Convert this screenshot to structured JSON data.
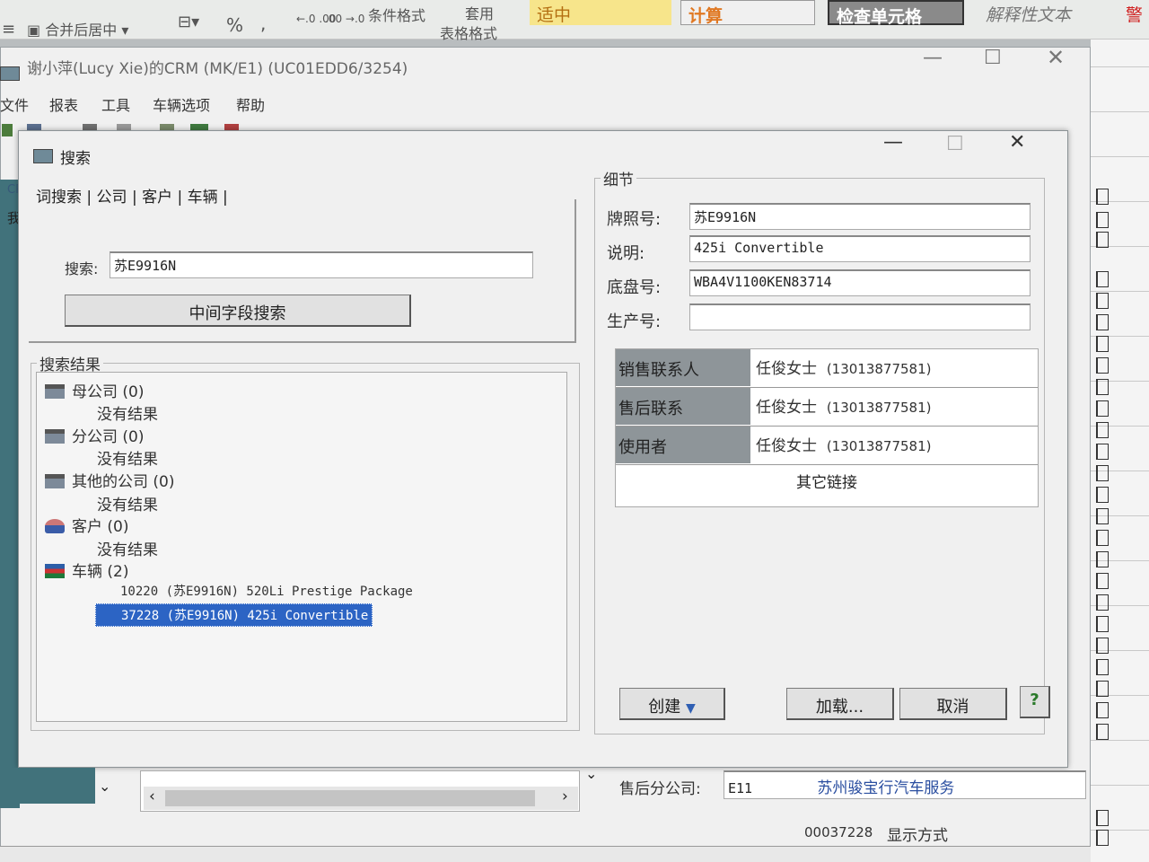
{
  "excel_ribbon": {
    "merge_center": "合并后居中",
    "percent": "%",
    "comma": ",",
    "decimal_increase": "←.0 .00",
    "decimal_decrease": ".00 →.0",
    "conditional_format": "条件格式",
    "apply_table_format_1": "套用",
    "apply_table_format_2": "表格格式",
    "style_neutral": "适中",
    "style_calc": "计算",
    "style_check_cell": "检查单元格",
    "style_explanatory": "解释性文本",
    "style_warning": "警"
  },
  "crm_window": {
    "title": "谢小萍(Lucy Xie)的CRM (MK/E1) (UC01EDD6/3254)",
    "menu": [
      "文件",
      "报表",
      "工具",
      "车辆选项",
      "帮助"
    ]
  },
  "dialog": {
    "title": "搜索",
    "search_tabs": "词搜索 | 公司 | 客户 | 车辆 |",
    "search_label": "搜索:",
    "search_value": "苏E9916N",
    "mid_field_search_button": "中间字段搜索",
    "results_legend": "搜索结果",
    "results": [
      {
        "label": "母公司",
        "count": "(0)",
        "icon": "factory-icon",
        "child": "没有结果"
      },
      {
        "label": "分公司",
        "count": "(0)",
        "icon": "factory-icon",
        "child": "没有结果"
      },
      {
        "label": "其他的公司",
        "count": "(0)",
        "icon": "factory-icon",
        "child": "没有结果"
      },
      {
        "label": "客户",
        "count": "(0)",
        "icon": "customer-icon",
        "child": "没有结果"
      },
      {
        "label": "车辆",
        "count": "(2)",
        "icon": "vehicle-icon"
      }
    ],
    "vehicle_results": [
      "10220 (苏E9916N) 520Li Prestige Package",
      "37228 (苏E9916N) 425i Convertible"
    ],
    "details_legend": "细节",
    "plate_label": "牌照号:",
    "plate_value": "苏E9916N",
    "desc_label": "说明:",
    "desc_value": "425i Convertible",
    "chassis_label": "底盘号:",
    "chassis_value": "WBA4V1100KEN83714",
    "production_label": "生产号:",
    "production_value": "",
    "contacts": [
      {
        "role": "销售联系人",
        "name": "任俊女士",
        "phone": "(13013877581)"
      },
      {
        "role": "售后联系",
        "name": "任俊女士",
        "phone": "(13013877581)"
      },
      {
        "role": "使用者",
        "name": "任俊女士",
        "phone": "(13013877581)"
      }
    ],
    "other_links": "其它链接",
    "create_button": "创建",
    "load_button": "加载...",
    "cancel_button": "取消",
    "help_button": "?"
  },
  "crm_bottom": {
    "aftersales_label": "售后分公司:",
    "aftersales_code": "E11",
    "aftersales_name": "苏州骏宝行汽车服务",
    "record_number": "00037228",
    "display_mode": "显示方式"
  }
}
